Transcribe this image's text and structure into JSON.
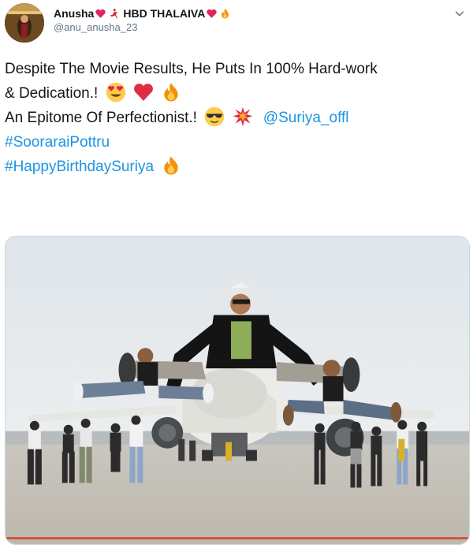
{
  "user": {
    "display_name": "Anusha",
    "display_name_suffix": "HBD THALAIVA",
    "handle": "@anu_anusha_23",
    "name_emojis": [
      "red-heart",
      "dancer",
      "red-heart",
      "fire"
    ]
  },
  "tweet": {
    "line1": "Despite The Movie Results, He Puts In 100% Hard-work",
    "line2": "& Dedication.!",
    "line2_emojis": [
      "heart-eyes",
      "red-heart",
      "fire"
    ],
    "line3": "An Epitome Of Perfectionist.!",
    "line3_emojis": [
      "sunglasses-face",
      "collision"
    ],
    "mention": "@Suriya_offl",
    "hashtag1": "#SooraraiPottru",
    "hashtag2": "#HappyBirthdaySuriya",
    "hashtag2_emojis": [
      "fire"
    ]
  },
  "media": {
    "description_icon": "photo",
    "scene": "group-jumping-in-front-of-airplane"
  },
  "colors": {
    "link": "#1b95e0",
    "text": "#14171a",
    "secondary": "#657786",
    "heart": "#e0245e",
    "fire": "#f4900c"
  },
  "menu": {
    "icon": "chevron-down-icon"
  }
}
